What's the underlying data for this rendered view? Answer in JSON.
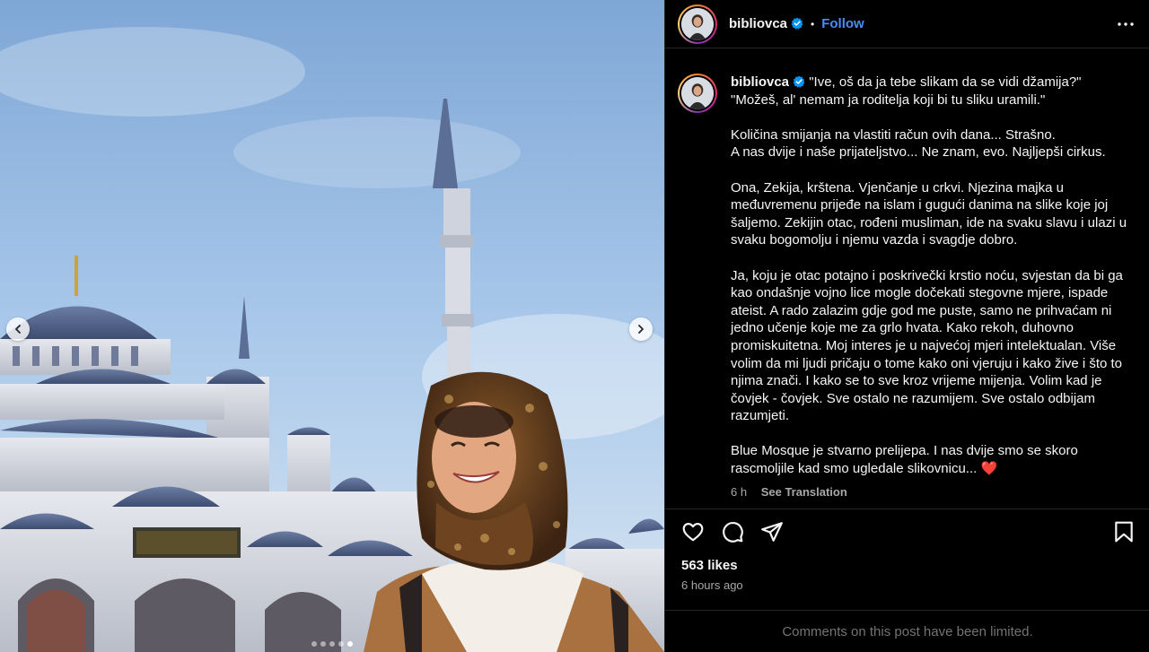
{
  "post": {
    "username": "bibliovca",
    "follow_label": "Follow",
    "separator": "•",
    "caption": "\"Ive, oš da ja tebe slikam da se vidi džamija?\"\n\"Možeš, al' nemam ja roditelja koji bi tu sliku uramili.\"\n\nKoličina smijanja na vlastiti račun ovih dana... Strašno.\nA nas dvije i naše prijateljstvo... Ne znam, evo. Najljepši cirkus.\n\nOna, Zekija, krštena. Vjenčanje u crkvi. Njezina majka u međuvremenu prijeđe na islam i gugući danima na slike koje joj šaljemo. Zekijin otac, rođeni musliman, ide na svaku slavu i ulazi u svaku bogomolju i njemu vazda i svagdje dobro.\n\nJa, koju je otac potajno i poskrivečki krstio noću, svjestan da bi ga kao ondašnje vojno lice mogle dočekati stegovne mjere, ispade ateist. A rado zalazim gdje god me puste, samo ne prihvaćam ni jedno učenje koje me za grlo hvata. Kako rekoh, duhovno promiskuitetna. Moj interes je u najvećoj mjeri intelektualan. Više volim da mi ljudi pričaju o tome kako oni vjeruju i kako žive i što to njima znači. I kako se to sve kroz vrijeme mijenja. Volim kad je čovjek - čovjek. Sve ostalo ne razumijem. Sve ostalo odbijam razumjeti.\n\nBlue Mosque je stvarno prelijepa. I nas dvije smo se skoro rascmoljile kad smo ugledale slikovnicu... ❤️",
    "time_short": "6 h",
    "see_translation": "See Translation",
    "likes": "563 likes",
    "time_ago": "6 hours ago",
    "comments_limited": "Comments on this post have been limited."
  },
  "carousel": {
    "slide_count": 5,
    "active_index": 4
  },
  "icons": {
    "verified": "verified-badge-icon",
    "more": "more-options-icon",
    "like": "heart-icon",
    "comment": "comment-icon",
    "share": "share-icon",
    "save": "bookmark-icon",
    "prev": "chevron-left-icon",
    "next": "chevron-right-icon"
  },
  "colors": {
    "background": "#000000",
    "text": "#f5f5f5",
    "muted": "#a8a8a8",
    "follow": "#4a8cf7",
    "verified": "#0095f6",
    "divider": "#262626"
  }
}
